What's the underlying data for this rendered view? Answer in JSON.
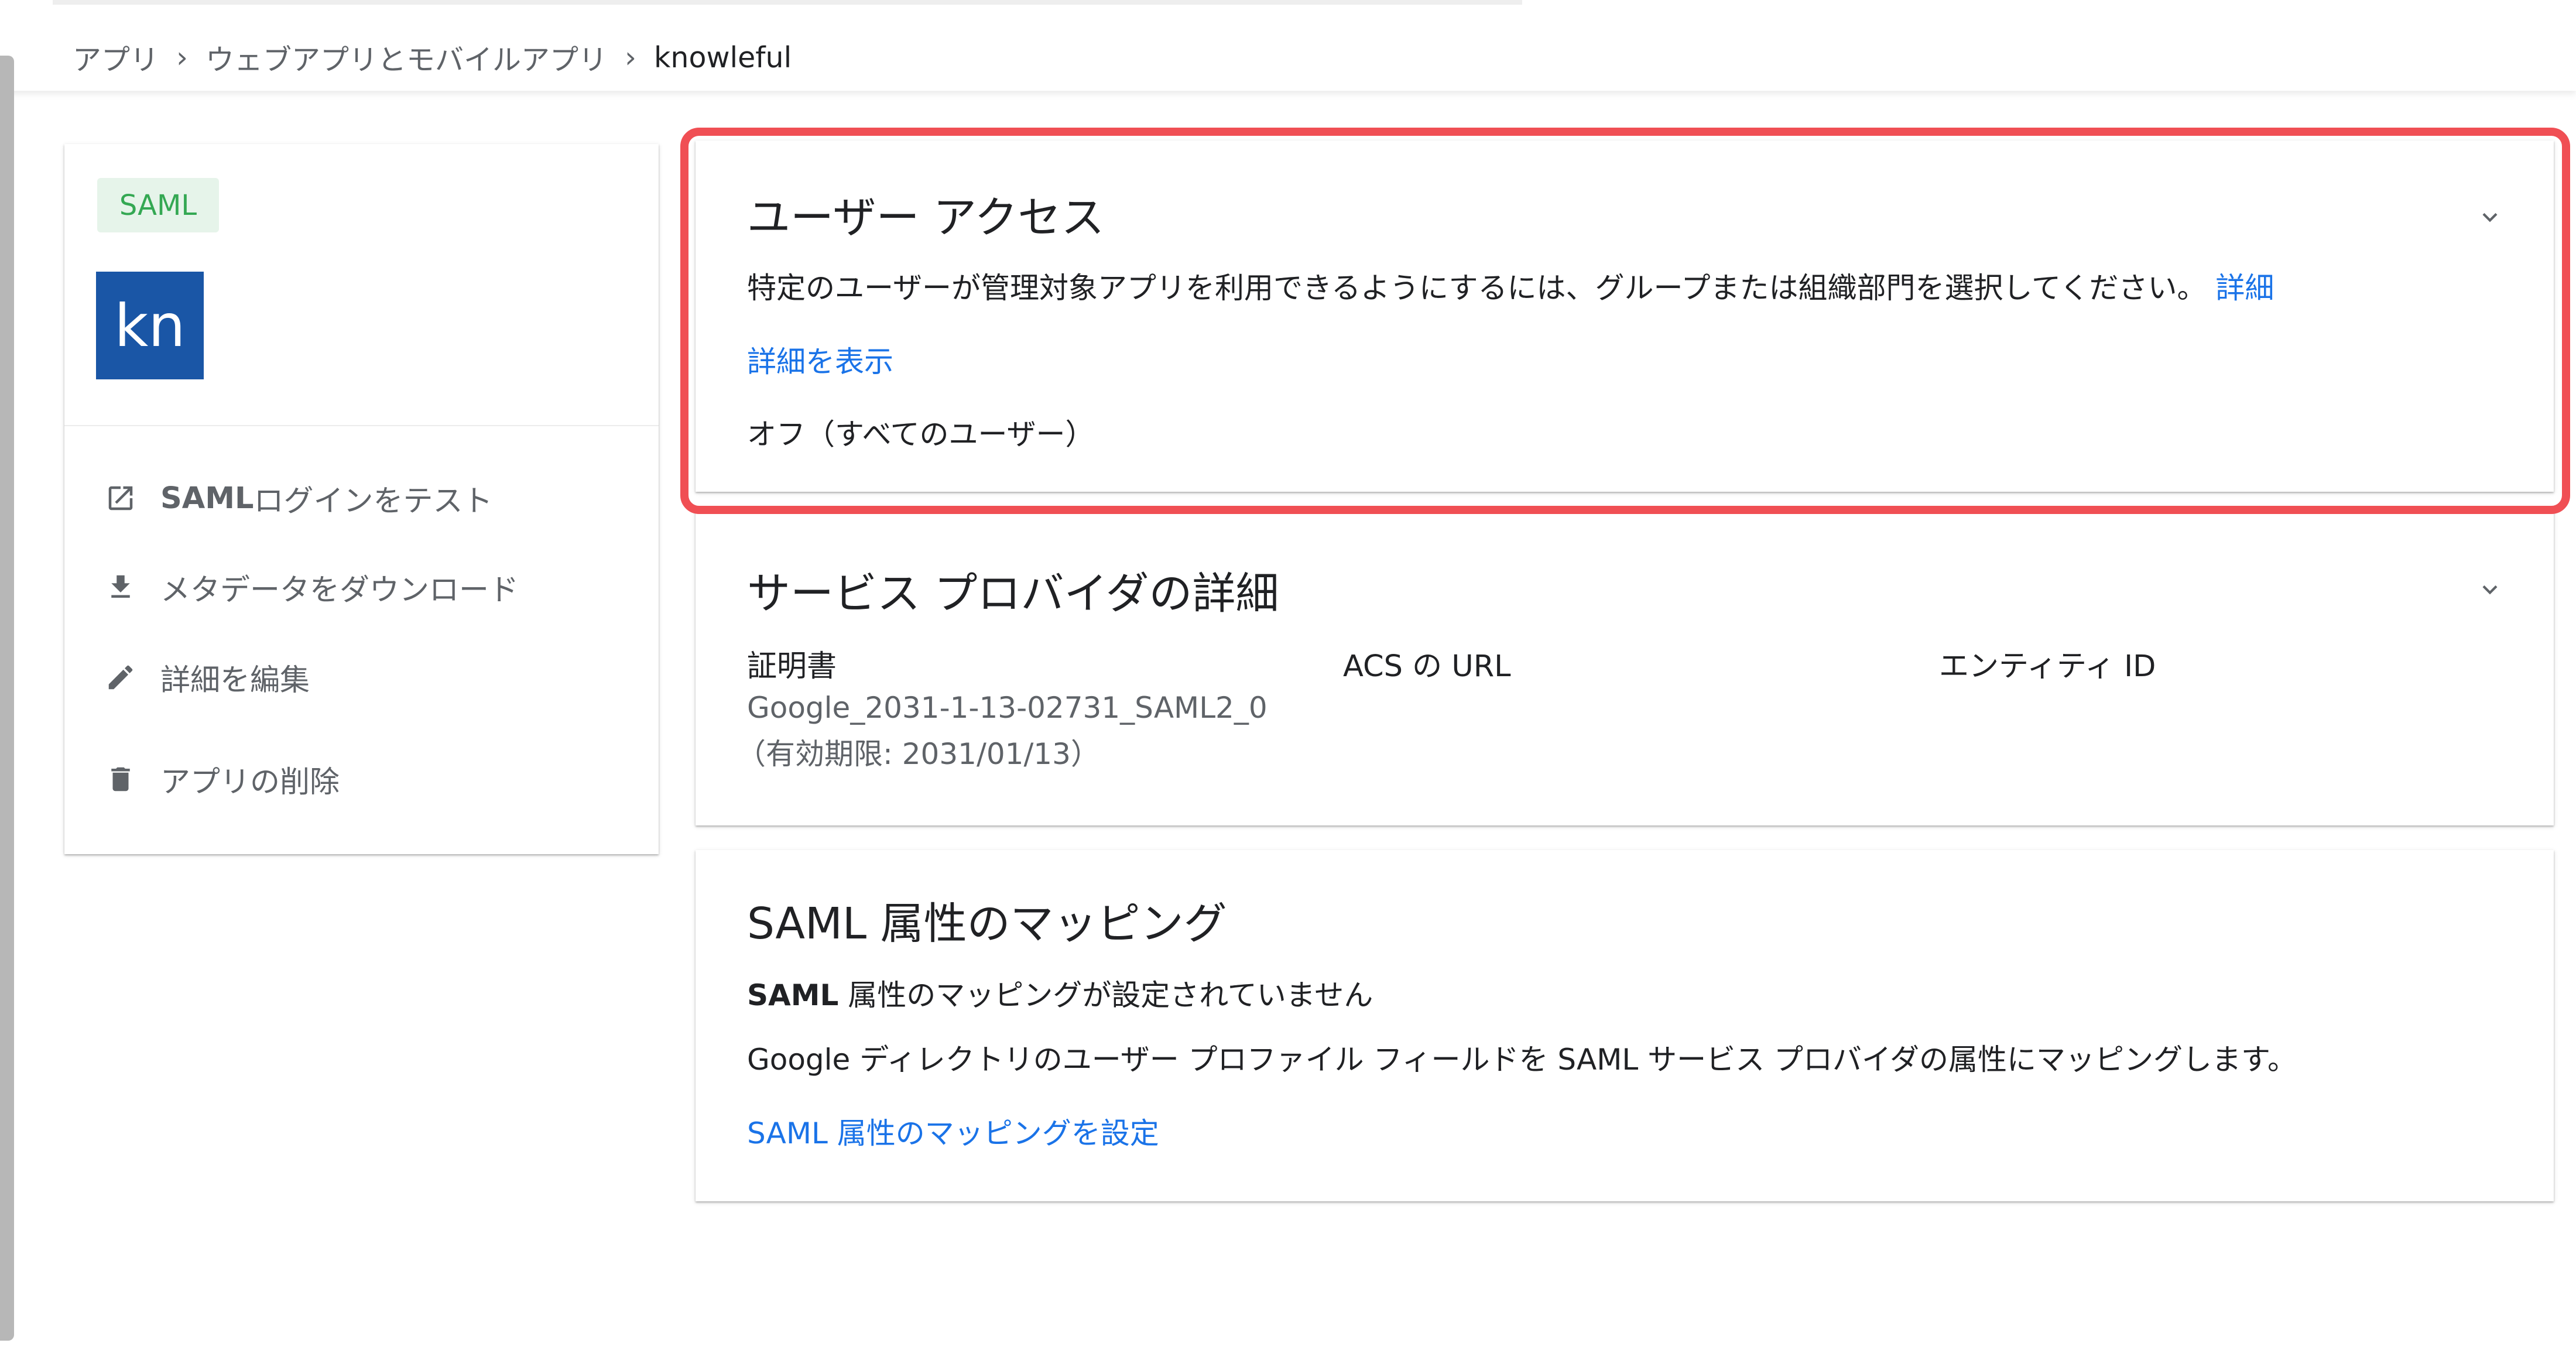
{
  "breadcrumb": {
    "items": [
      "アプリ",
      "ウェブアプリとモバイルアプリ",
      "knowleful"
    ],
    "separator": "›"
  },
  "sidebar": {
    "badge": "SAML",
    "logo_text": "kn",
    "logo_color": "#1a56a6",
    "actions": [
      {
        "icon": "external-link-icon",
        "label_bold": "SAML",
        "label": " ログインをテスト"
      },
      {
        "icon": "download-icon",
        "label_bold": "",
        "label": "メタデータをダウンロード"
      },
      {
        "icon": "pencil-icon",
        "label_bold": "",
        "label": "詳細を編集"
      },
      {
        "icon": "trash-icon",
        "label_bold": "",
        "label": "アプリの削除"
      }
    ]
  },
  "user_access": {
    "title": "ユーザー アクセス",
    "description": "特定のユーザーが管理対象アプリを利用できるようにするには、グループまたは組織部門を選択してください。",
    "details_link": "詳細",
    "show_details_link": "詳細を表示",
    "status": "オフ（すべてのユーザー）"
  },
  "service_provider": {
    "title": "サービス プロバイダの詳細",
    "columns": [
      "証明書",
      "ACS の URL",
      "エンティティ ID"
    ],
    "certificate_name": "Google_2031-1-13-02731_SAML2_0",
    "certificate_expiry": "（有効期限: 2031/01/13）"
  },
  "saml_mapping": {
    "title": "SAML 属性のマッピング",
    "status_bold": "SAML",
    "status": " 属性のマッピングが設定されていません",
    "description": "Google ディレクトリのユーザー プロファイル フィールドを SAML サービス プロバイダの属性にマッピングします。",
    "setup_link": "SAML 属性のマッピングを設定"
  },
  "colors": {
    "accent": "#1a73e8",
    "highlight": "#f04f54",
    "saml_badge_bg": "#e6f4ea",
    "saml_badge_fg": "#34a853"
  }
}
